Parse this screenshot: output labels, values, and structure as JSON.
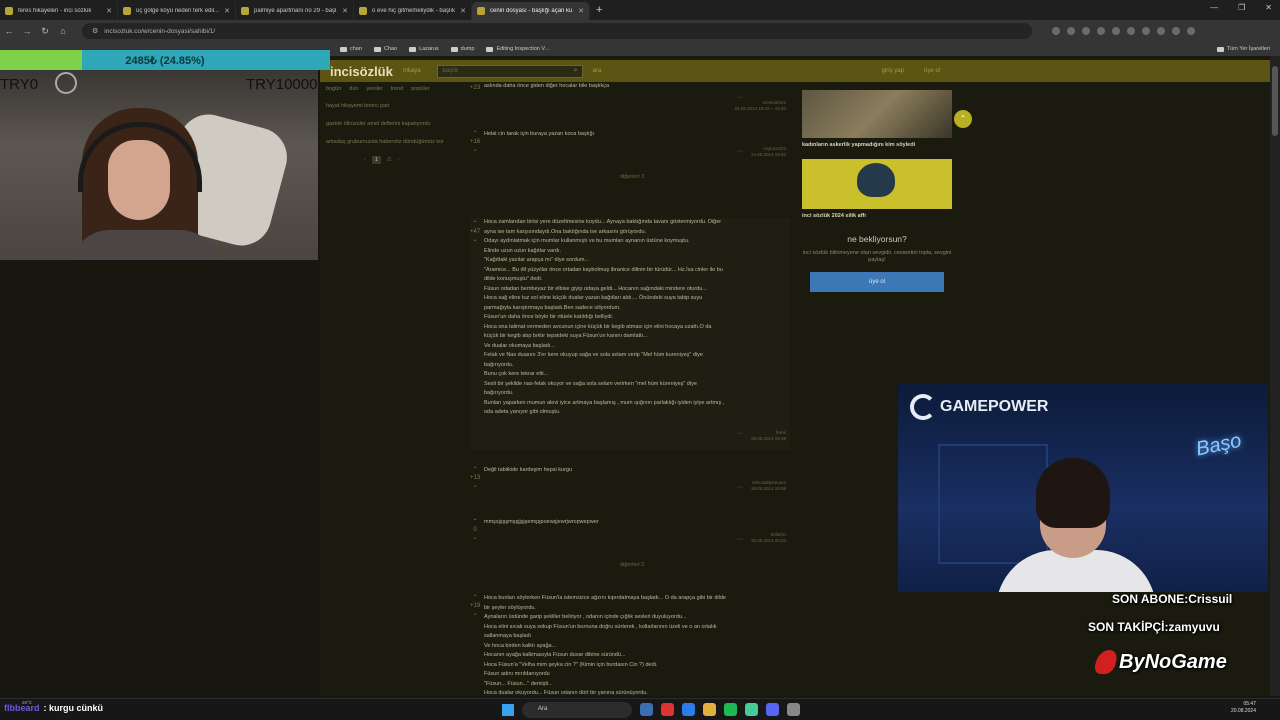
{
  "browser": {
    "tabs": [
      {
        "label": "feres hikayeleri - inci sözlük",
        "active": false
      },
      {
        "label": "üç gölge köyü neden terk edil...",
        "active": false
      },
      {
        "label": "palmiye apartmanı no 29 - başl...",
        "active": false
      },
      {
        "label": "o eve hiç gitmemeliydik - başlık...",
        "active": false
      },
      {
        "label": "cenin dosyası - başlığı açan ku...",
        "active": true
      }
    ],
    "url": "incisozluk.co/w/cenin-dosyasi/sahibi/1/",
    "bookmarks": [
      "chan",
      "Chao",
      "Lazarus",
      "dump",
      "Editing Inspection V..."
    ],
    "all_bookmarks": "Tüm Yer İşaretleri"
  },
  "site": {
    "logo": "incisözlük",
    "header_link": "mkaya",
    "search_placeholder": "başlık",
    "search_extra": "ara",
    "header_right": [
      "giriş yap",
      "üye ol"
    ],
    "left": {
      "tabs": [
        "bugün",
        "dün",
        "yeniler",
        "trend",
        "popüler"
      ],
      "items": [
        "hayat hikayemi birinci part",
        "gazide ölküsüler amel defterini kapatıyordu",
        "arkadaş grubumuzda haberstiz döndüğümüz koi"
      ],
      "pager": {
        "current": "1",
        "total": "/1"
      }
    },
    "entries": [
      {
        "votes": "+23",
        "text": "aslında daha önce giden diğer hocalar bile başlıkça",
        "author": "meetcafe23",
        "date": "24.06.2014 19:19 ~ 19:40"
      },
      {
        "votes": "+16",
        "text": "Helal cin tarak için buraya yazan koca başlığı",
        "author": "ceylucu223",
        "date": "24.06.2014 19:40"
      },
      {
        "more": "diğerleri 3"
      },
      {
        "votes": "+47",
        "text": [
          "Hoca zamlarıdan birisi yere düzeltmesine koydu... Aynaya baktığında tavanı göstermiyordu. Diğer",
          "ayna ise tam karşısındaydı.Ona baktığında ise arkasını görüyordu.",
          "Odayı aydınlatmak için mumlar kullanmıştı ve bu mumları aynanın üstüne koymuştu.",
          "Elinde uzun uzun kağıtlar vardı.",
          "\"Kağıttaki yazılar arapça mı\" diye sordum...",
          "\"Aramice... Bu dil yüzyıllar önce ortadan kaybolmuş ibranice dilinin bir türüdür... Hz.İsa cinler ile bu",
          "dilde konuşmuştu\" dedi.",
          "Füsun odadan bembeyaz bir elbise giyip odaya geldi... Hocanın sağındaki mindere oturdu...",
          "Hoca sağ eline tuz sol eline küçük dualar yazan kağıtları aldı.... Önündeki suya tabip suyu",
          "parmağıyla karıştırmaya başladı.Ben sadece izliyordum.",
          "Füsun'un daha önce böyle bir ritüele katıldığı belliydi.",
          "Hoca ona talimat vermeden avcunun içine küçük bir kegib atması için elini hocaya uzattı.O da",
          "küçük bir kegib atıp bıktır tepsideki suya Füsun'un kanını damlattı...",
          "Ve dualar okumaya başladı...",
          "Felak ve Nas duasını 3'er kere okuyup sağa ve sola selam verip \"Mel hüm kureniyeş\" diye",
          "bağırıyordu.",
          "Bunu çok kere tekrar etti...",
          "Sesli bir şekilde nas-felak okuyor ve sağa sola selam verirken \"mel hüm küreniyeş\" diye",
          "bağırıyordu.",
          "Bunları yaparken mumun alevi iyice artmaya başlamış , mum ışığının parlaklığı iyiden iyiye artmış ,",
          "oda adeta yanıyor gibi olmuştu."
        ],
        "author": "feres",
        "date": "28.06.2014 19:48"
      },
      {
        "votes": "+13",
        "text": "Değil tabiikide kardeşim hepsi kurgu",
        "author": "mikrotabipseuom",
        "date": "28.06.2014 19:58"
      },
      {
        "votes": "0",
        "text": "mmşsjşşşmşşjjşjşemşşpoewşjewrjwropwepwer",
        "author": "50litelin",
        "date": "28.06.2014 20:03"
      },
      {
        "more": "diğerleri 2"
      },
      {
        "votes": "+19",
        "text": [
          "Hoca bunları söylerken Füsun'la istemsizce ağzını kıpırdatmaya başladı... O da arapça gibi bir dilde",
          "bir şeyler söylüyordu.",
          "Aynaların üstünde garip şekiller beliriyor , odanın içinde çığlık sesleri duyuluyordu...",
          "Hoca elini sıcak suya sokup Füsun'un burnuna doğru sürterek , kollarlarının üzeli ve o an ortalık",
          "sallanmaya başladı",
          "Ve hoca birden kalktı ayağa...",
          "Hocanın ayağa kalkmasıyla Füsun duvar dibine süründü...",
          "Hoca Füsun'a \"Velha mim şeyka cin ?\" (Kimin için burdasın Cin ?) dedi.",
          "Füsun adını mırıldanıyordu",
          "\"Füsun... Füsun...\" demişti...",
          "Hoca dualar okuyordu... Füsun odanın dört bir yanına sürünüyordu."
        ]
      }
    ],
    "sidebar_cards": [
      {
        "caption": "kadınların askerlik yapmadığını kim söyledi"
      },
      {
        "caption": "inci sözlük 2024 silik affı"
      }
    ],
    "cta": {
      "title": "ne bekliyorsun?",
      "text": "inci sözlük bilinmeyene olan sevgidir. cesaretini topla, sevgini paylaş!",
      "button": "üye ol"
    }
  },
  "overlay": {
    "donation_text": "2485₺ (24.85%)",
    "donation_fraction": 0.2485,
    "min_label": "TRY0",
    "max_label": "TRY10000",
    "gamepower": "GAMEPOWER",
    "neon_sign": "Başo",
    "last_sub": "SON ABONE:Crissuil",
    "last_follower": "SON TAKİPÇİ:zamyuvu",
    "sponsor": "ByNoGame",
    "chat_user": "flbbeard",
    "chat_msg": ": kurgu cünkü"
  },
  "taskbar": {
    "weather": "26°C",
    "search": "Ara",
    "time": "05:47",
    "date": "20.08.2024"
  },
  "colors": {
    "site_header": "#5c5412",
    "accent_yellow": "#c9c02b",
    "cta_button": "#3b78b5",
    "donation_bar": "#2ea7b8",
    "donation_fill": "#7fd14a"
  }
}
